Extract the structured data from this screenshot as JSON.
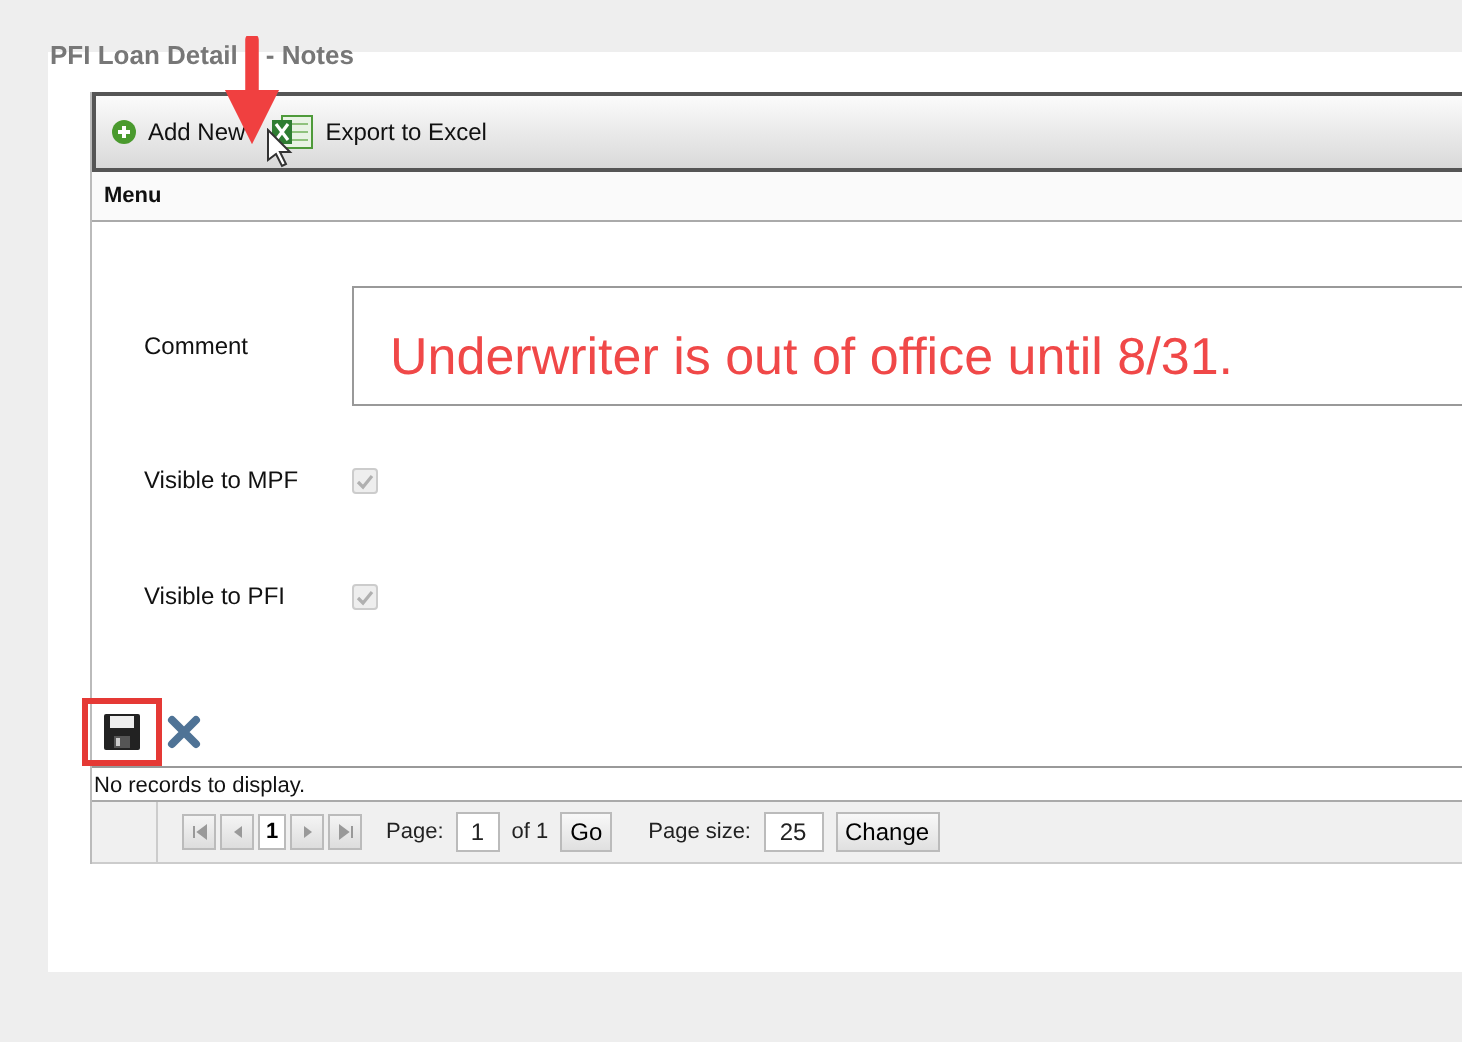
{
  "page_title_parts": [
    "PFI Loan Detail",
    "- Notes"
  ],
  "toolbar": [
    {
      "kind": "add",
      "label": "Add New"
    },
    {
      "kind": "excel",
      "label": "Export to Excel"
    }
  ],
  "menu_header": "Menu",
  "form": [
    {
      "kind": "text",
      "label": "Comment",
      "value": "Underwriter is out of office until 8/31."
    },
    {
      "kind": "checkbox",
      "label": "Visible to MPF",
      "checked": true,
      "disabled": true
    },
    {
      "kind": "checkbox",
      "label": "Visible to PFI",
      "checked": true,
      "disabled": true
    }
  ],
  "status": "No records to display.",
  "pager": {
    "current": "1",
    "page_label": "Page:",
    "page_value": "1",
    "of": "of 1",
    "go": "Go",
    "size_label": "Page size:",
    "size_value": "25",
    "change": "Change"
  },
  "annotations": {
    "arrow": true,
    "highlight_save": true
  }
}
